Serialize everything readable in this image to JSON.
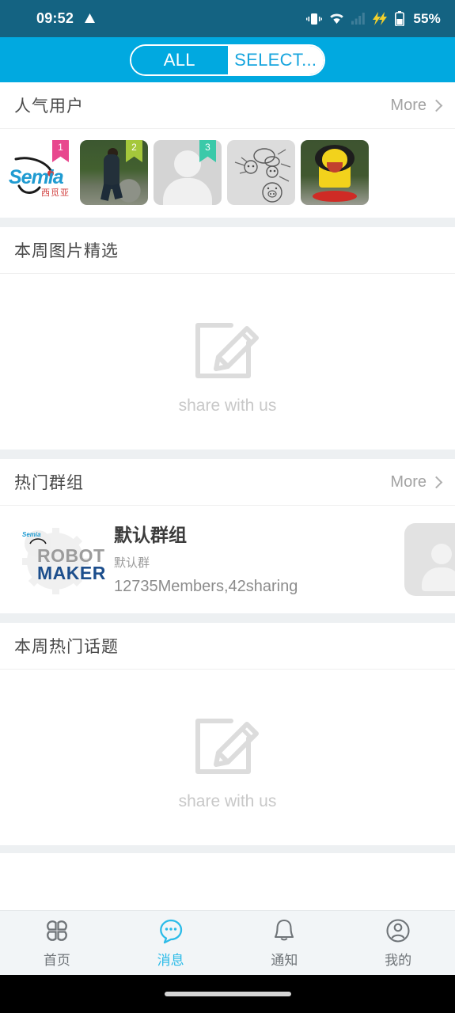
{
  "status_bar": {
    "time": "09:52",
    "warning_icon": "triangle-warning-icon",
    "vibrate_icon": "vibrate-icon",
    "wifi_icon": "wifi-icon",
    "signal_icon": "signal-bars-icon",
    "charging_icon": "lightning-bolt-icon",
    "battery_icon": "battery-icon",
    "battery_text": "55%",
    "bg_color": "#146382"
  },
  "header": {
    "accent_color": "#01A9E0",
    "segments": [
      {
        "label": "ALL",
        "active": true
      },
      {
        "label": "SELECT...",
        "active": false
      }
    ]
  },
  "sections": {
    "popular_users": {
      "title": "人气用户",
      "more_label": "More",
      "avatars": [
        {
          "name": "Semia",
          "rank": "1",
          "rank_color": "#E8488E",
          "logo_text": "Semia",
          "logo_cn": "西觅亚"
        },
        {
          "name": "hillside-photo",
          "rank": "2",
          "rank_color": "#A5C73B"
        },
        {
          "name": "default-person",
          "rank": "3",
          "rank_color": "#3BC9A9"
        },
        {
          "name": "doodle-sketch",
          "rank": ""
        },
        {
          "name": "yellow-lion-photo",
          "rank": ""
        }
      ]
    },
    "weekly_pictures": {
      "title": "本周图片精选",
      "empty_label": "share with us",
      "empty_icon": "compose-pencil-icon"
    },
    "hot_groups": {
      "title": "热门群组",
      "more_label": "More",
      "groups": [
        {
          "logo_top": "ROBOT",
          "logo_bottom": "MAKER",
          "logo_badge": "Semia",
          "name": "默认群组",
          "subtitle": "默认群",
          "meta": "12735Members,42sharing"
        }
      ]
    },
    "weekly_topics": {
      "title": "本周热门话题",
      "empty_label": "share with us",
      "empty_icon": "compose-pencil-icon"
    }
  },
  "tab_bar": {
    "active_color": "#2BBBE8",
    "inactive_color": "#6F7478",
    "tabs": [
      {
        "label": "首页",
        "icon": "grid-clover-icon",
        "active": false
      },
      {
        "label": "消息",
        "icon": "chat-bubble-icon",
        "active": true
      },
      {
        "label": "通知",
        "icon": "bell-icon",
        "active": false
      },
      {
        "label": "我的",
        "icon": "person-circle-icon",
        "active": false
      }
    ]
  }
}
